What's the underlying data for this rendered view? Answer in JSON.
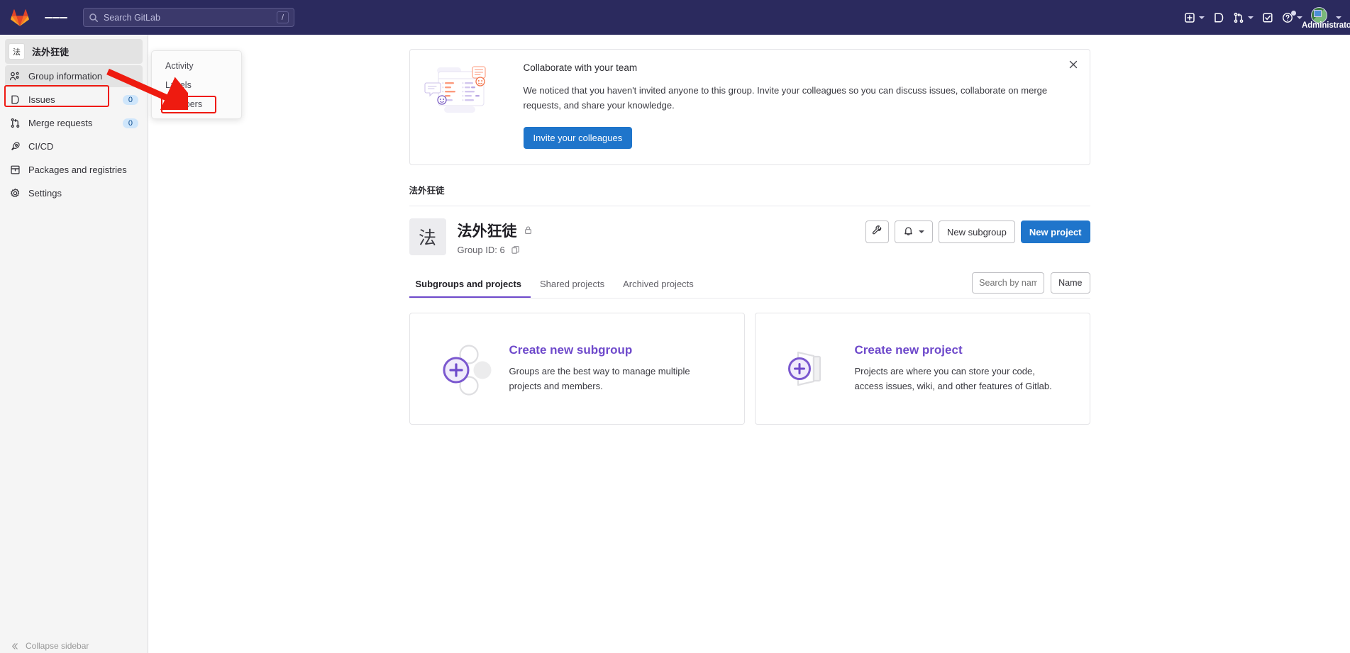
{
  "topnav": {
    "logo_icon": "gitlab-logo-icon",
    "menu_icon": "hamburger-menu-icon",
    "search": {
      "placeholder": "Search GitLab",
      "shortcut": "/",
      "icon": "search-icon"
    },
    "actions": [
      {
        "name": "create-new-menu",
        "icon": "plus-square-icon",
        "has_caret": true
      },
      {
        "name": "issues-nav",
        "icon": "issues-icon",
        "has_caret": false
      },
      {
        "name": "merge-requests-nav",
        "icon": "merge-request-icon",
        "has_caret": true
      },
      {
        "name": "todos-nav",
        "icon": "todo-check-icon",
        "has_caret": false
      },
      {
        "name": "help-menu",
        "icon": "question-circle-icon",
        "has_caret": true,
        "badge_dot": true
      }
    ],
    "user": {
      "name": "Administrato",
      "full_name": "Administrator",
      "avatar_icon": "broken-image-avatar-icon"
    }
  },
  "sidebar": {
    "group": {
      "initial": "法",
      "name": "法外狂徒"
    },
    "items": [
      {
        "label": "Group information",
        "icon": "group-info-icon",
        "active": true,
        "badge": null
      },
      {
        "label": "Issues",
        "icon": "issues-icon",
        "active": false,
        "badge": "0"
      },
      {
        "label": "Merge requests",
        "icon": "merge-request-icon",
        "active": false,
        "badge": "0"
      },
      {
        "label": "CI/CD",
        "icon": "rocket-icon",
        "active": false,
        "badge": null
      },
      {
        "label": "Packages and registries",
        "icon": "package-icon",
        "active": false,
        "badge": null
      },
      {
        "label": "Settings",
        "icon": "gear-icon",
        "active": false,
        "badge": null
      }
    ],
    "collapse_label": "Collapse sidebar",
    "collapse_icon": "chevron-double-left-icon"
  },
  "flyout": {
    "items": [
      {
        "label": "Activity",
        "highlighted": false
      },
      {
        "label": "Labels",
        "highlighted": false
      },
      {
        "label": "Members",
        "highlighted": true
      }
    ]
  },
  "annotations": {
    "highlight_color": "#ef1a12",
    "arrow": "red-arrow-pointing-to-members"
  },
  "banner": {
    "title": "Collaborate with your team",
    "text": "We noticed that you haven't invited anyone to this group. Invite your colleagues so you can discuss issues, collaborate on merge requests, and share your knowledge.",
    "button_label": "Invite your colleagues",
    "close_icon": "close-x-icon",
    "illustration": "team-collaboration-illustration"
  },
  "breadcrumb": "法外狂徒",
  "group_header": {
    "avatar_initial": "法",
    "title": "法外狂徒",
    "visibility_icon": "lock-icon",
    "group_id_label": "Group ID: 6",
    "copy_icon": "copy-to-clipboard-icon",
    "actions": {
      "settings_icon": "wrench-icon",
      "notification_icon": "bell-icon",
      "new_subgroup_label": "New subgroup",
      "new_project_label": "New project"
    }
  },
  "tabs": [
    {
      "label": "Subgroups and projects",
      "active": true
    },
    {
      "label": "Shared projects",
      "active": false
    },
    {
      "label": "Archived projects",
      "active": false
    }
  ],
  "filters": {
    "search_placeholder": "Search by name",
    "sort_label": "Name"
  },
  "cards": [
    {
      "title": "Create new subgroup",
      "text": "Groups are the best way to manage multiple projects and members.",
      "illustration": "subgroup-nodes-plus-illustration"
    },
    {
      "title": "Create new project",
      "text": "Projects are where you can store your code, access issues, wiki, and other features of Gitlab.",
      "illustration": "project-folder-plus-illustration"
    }
  ],
  "colors": {
    "nav_background": "#2b2a5e",
    "primary_button": "#1f75cb",
    "accent_purple": "#6e49cb",
    "sidebar_background": "#f5f5f5",
    "annotation_red": "#ef1a12"
  }
}
